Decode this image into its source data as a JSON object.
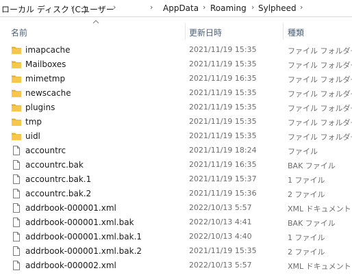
{
  "breadcrumb": {
    "items": [
      "ローカル ディスク (C:)",
      "ユーザー",
      "AppData",
      "Roaming",
      "Sylpheed"
    ]
  },
  "columns": {
    "name": "名前",
    "date": "更新日時",
    "type": "種類"
  },
  "sort": {
    "column": "name",
    "direction": "ascending"
  },
  "colors": {
    "folder": "#f5c84c",
    "folder_dark": "#e0a92a",
    "file_outline": "#7a7a7a",
    "header_text": "#4c607a"
  },
  "files": [
    {
      "icon": "folder-icon",
      "name": "imapcache",
      "date": "2021/11/19 15:35",
      "type": "ファイル フォルダー"
    },
    {
      "icon": "folder-icon",
      "name": "Mailboxes",
      "date": "2021/11/19 15:35",
      "type": "ファイル フォルダー"
    },
    {
      "icon": "folder-icon",
      "name": "mimetmp",
      "date": "2021/11/19 16:35",
      "type": "ファイル フォルダー"
    },
    {
      "icon": "folder-icon",
      "name": "newscache",
      "date": "2021/11/19 15:35",
      "type": "ファイル フォルダー"
    },
    {
      "icon": "folder-icon",
      "name": "plugins",
      "date": "2021/11/19 15:35",
      "type": "ファイル フォルダー"
    },
    {
      "icon": "folder-icon",
      "name": "tmp",
      "date": "2021/11/19 15:35",
      "type": "ファイル フォルダー"
    },
    {
      "icon": "folder-icon",
      "name": "uidl",
      "date": "2021/11/19 15:35",
      "type": "ファイル フォルダー"
    },
    {
      "icon": "file-icon",
      "name": "accountrc",
      "date": "2021/11/19 18:24",
      "type": "ファイル"
    },
    {
      "icon": "file-icon",
      "name": "accountrc.bak",
      "date": "2021/11/19 16:35",
      "type": "BAK ファイル"
    },
    {
      "icon": "file-icon",
      "name": "accountrc.bak.1",
      "date": "2021/11/19 15:37",
      "type": "1 ファイル"
    },
    {
      "icon": "file-icon",
      "name": "accountrc.bak.2",
      "date": "2021/11/19 15:36",
      "type": "2 ファイル"
    },
    {
      "icon": "file-icon",
      "name": "addrbook-000001.xml",
      "date": "2022/10/13 5:57",
      "type": "XML ドキュメント"
    },
    {
      "icon": "file-icon",
      "name": "addrbook-000001.xml.bak",
      "date": "2022/10/13 4:41",
      "type": "BAK ファイル"
    },
    {
      "icon": "file-icon",
      "name": "addrbook-000001.xml.bak.1",
      "date": "2022/10/13 4:40",
      "type": "1 ファイル"
    },
    {
      "icon": "file-icon",
      "name": "addrbook-000001.xml.bak.2",
      "date": "2021/11/19 15:35",
      "type": "2 ファイル"
    },
    {
      "icon": "file-icon",
      "name": "addrbook-000002.xml",
      "date": "2022/10/13 5:57",
      "type": "XML ドキュメント"
    }
  ]
}
